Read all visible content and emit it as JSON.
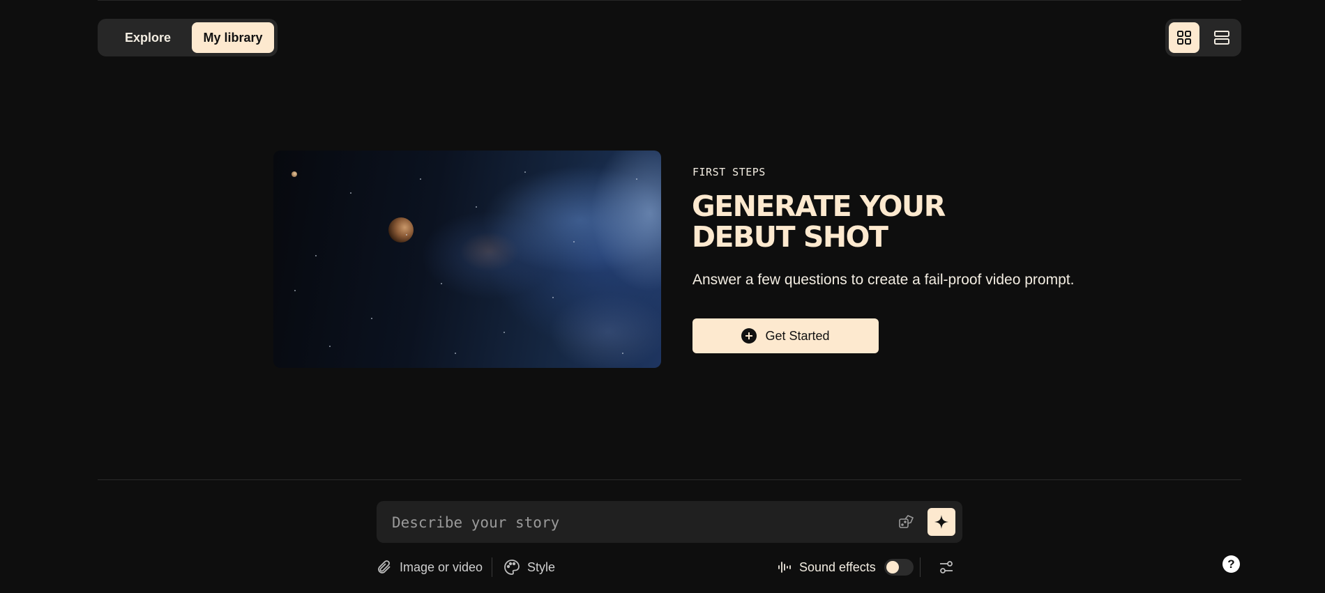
{
  "nav": {
    "tabs": [
      {
        "label": "Explore",
        "active": false
      },
      {
        "label": "My library",
        "active": true
      }
    ]
  },
  "view_toggle": {
    "options": [
      {
        "icon": "grid-view-icon",
        "active": true
      },
      {
        "icon": "list-view-icon",
        "active": false
      }
    ]
  },
  "hero": {
    "eyebrow": "FIRST STEPS",
    "title_line1": "GENERATE YOUR",
    "title_line2": "DEBUT SHOT",
    "subtitle": "Answer a few questions to create a fail-proof video prompt.",
    "cta_label": "Get Started",
    "image_subject": "space-nebula-with-planet"
  },
  "prompt": {
    "placeholder": "Describe your story",
    "value": ""
  },
  "toolbar": {
    "attach_label": "Image or video",
    "style_label": "Style",
    "sound_label": "Sound effects",
    "sound_enabled": false
  },
  "help": {
    "label": "?"
  },
  "colors": {
    "background": "#0e0e0e",
    "accent": "#fde9cf",
    "surface": "#272727"
  }
}
